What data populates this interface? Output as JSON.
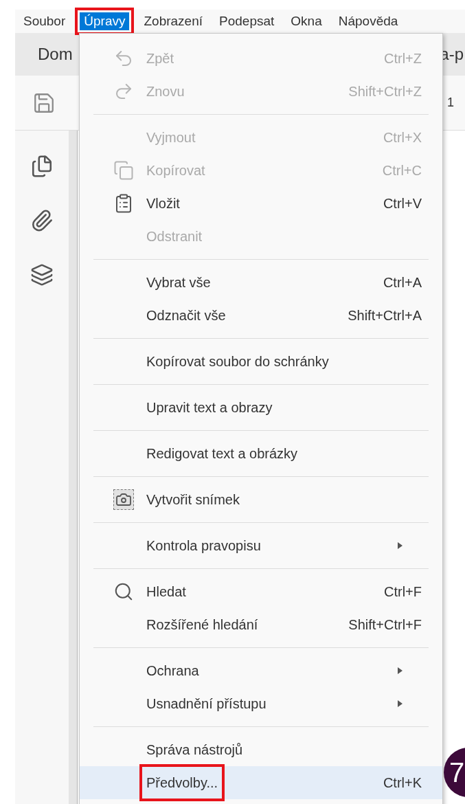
{
  "menubar": [
    {
      "label": "Soubor",
      "selected": false,
      "annotated": false
    },
    {
      "label": "Úpravy",
      "selected": true,
      "annotated": true
    },
    {
      "label": "Zobrazení",
      "selected": false,
      "annotated": false
    },
    {
      "label": "Podepsat",
      "selected": false,
      "annotated": false
    },
    {
      "label": "Okna",
      "selected": false,
      "annotated": false
    },
    {
      "label": "Nápověda",
      "selected": false,
      "annotated": false
    }
  ],
  "background": {
    "tab_label": "Dom",
    "document_title": "a-p",
    "page_number": "1"
  },
  "menu": {
    "groups": [
      [
        {
          "label": "Zpět",
          "shortcut": "Ctrl+Z",
          "disabled": true,
          "submenu": false,
          "selected": false,
          "annotated": false
        },
        {
          "label": "Znovu",
          "shortcut": "Shift+Ctrl+Z",
          "disabled": true,
          "submenu": false,
          "selected": false,
          "annotated": false
        }
      ],
      [
        {
          "label": "Vyjmout",
          "shortcut": "Ctrl+X",
          "disabled": true,
          "submenu": false,
          "selected": false,
          "annotated": false
        },
        {
          "label": "Kopírovat",
          "shortcut": "Ctrl+C",
          "disabled": true,
          "submenu": false,
          "selected": false,
          "annotated": false
        },
        {
          "label": "Vložit",
          "shortcut": "Ctrl+V",
          "disabled": false,
          "submenu": false,
          "selected": false,
          "annotated": false
        },
        {
          "label": "Odstranit",
          "disabled": true,
          "submenu": false,
          "selected": false,
          "annotated": false
        }
      ],
      [
        {
          "label": "Vybrat vše",
          "shortcut": "Ctrl+A",
          "disabled": false,
          "submenu": false,
          "selected": false,
          "annotated": false
        },
        {
          "label": "Odznačit vše",
          "shortcut": "Shift+Ctrl+A",
          "disabled": false,
          "submenu": false,
          "selected": false,
          "annotated": false
        }
      ],
      [
        {
          "label": "Kopírovat soubor do schránky",
          "disabled": false,
          "submenu": false,
          "selected": false,
          "annotated": false
        }
      ],
      [
        {
          "label": "Upravit text a obrazy",
          "disabled": false,
          "submenu": false,
          "selected": false,
          "annotated": false
        }
      ],
      [
        {
          "label": "Redigovat text a obrázky",
          "disabled": false,
          "submenu": false,
          "selected": false,
          "annotated": false
        }
      ],
      [
        {
          "label": "Vytvořit snímek",
          "disabled": false,
          "submenu": false,
          "selected": false,
          "annotated": false
        }
      ],
      [
        {
          "label": "Kontrola pravopisu",
          "disabled": false,
          "submenu": true,
          "selected": false,
          "annotated": false
        }
      ],
      [
        {
          "label": "Hledat",
          "shortcut": "Ctrl+F",
          "disabled": false,
          "submenu": false,
          "selected": false,
          "annotated": false
        },
        {
          "label": "Rozšířené hledání",
          "shortcut": "Shift+Ctrl+F",
          "disabled": false,
          "submenu": false,
          "selected": false,
          "annotated": false
        }
      ],
      [
        {
          "label": "Ochrana",
          "disabled": false,
          "submenu": true,
          "selected": false,
          "annotated": false
        },
        {
          "label": "Usnadnění přístupu",
          "disabled": false,
          "submenu": true,
          "selected": false,
          "annotated": false
        }
      ],
      [
        {
          "label": "Správa nástrojů",
          "disabled": false,
          "submenu": false,
          "selected": false,
          "annotated": false
        },
        {
          "label": "Předvolby...",
          "shortcut": "Ctrl+K",
          "disabled": false,
          "submenu": false,
          "selected": true,
          "annotated": true
        }
      ]
    ]
  },
  "step_badge": "7"
}
